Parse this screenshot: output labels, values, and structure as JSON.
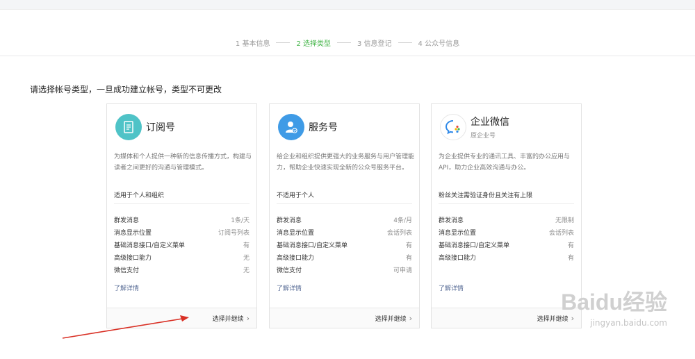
{
  "steps": [
    {
      "label": "1 基本信息"
    },
    {
      "label": "2 选择类型"
    },
    {
      "label": "3 信息登记"
    },
    {
      "label": "4 公众号信息"
    }
  ],
  "prompt": "请选择帐号类型，一旦成功建立帐号，类型不可更改",
  "cards": [
    {
      "title": "订阅号",
      "icon": "subscription-icon",
      "description": "为媒体和个人提供一种新的信息传播方式，构建与读者之间更好的沟通与管理模式。",
      "applies": "适用于个人和组织",
      "features": [
        {
          "name": "群发消息",
          "value": "1条/天"
        },
        {
          "name": "消息显示位置",
          "value": "订阅号列表"
        },
        {
          "name": "基础消息接口/自定义菜单",
          "value": "有"
        },
        {
          "name": "高级接口能力",
          "value": "无"
        },
        {
          "name": "微信支付",
          "value": "无"
        }
      ],
      "more": "了解详情",
      "continue": "选择并继续"
    },
    {
      "title": "服务号",
      "icon": "service-icon",
      "description": "给企业和组织提供更强大的业务服务与用户管理能力，帮助企业快速实现全新的公众号服务平台。",
      "applies": "不适用于个人",
      "features": [
        {
          "name": "群发消息",
          "value": "4条/月"
        },
        {
          "name": "消息显示位置",
          "value": "会话列表"
        },
        {
          "name": "基础消息接口/自定义菜单",
          "value": "有"
        },
        {
          "name": "高级接口能力",
          "value": "有"
        },
        {
          "name": "微信支付",
          "value": "可申请"
        }
      ],
      "more": "了解详情",
      "continue": "选择并继续"
    },
    {
      "title": "企业微信",
      "subtitle": "原企业号",
      "icon": "wecom-icon",
      "description": "为企业提供专业的通讯工具、丰富的办公应用与API，助力企业高效沟通与办公。",
      "applies": "粉丝关注需验证身份且关注有上限",
      "features": [
        {
          "name": "群发消息",
          "value": "无限制"
        },
        {
          "name": "消息显示位置",
          "value": "会话列表"
        },
        {
          "name": "基础消息接口/自定义菜单",
          "value": "有"
        },
        {
          "name": "高级接口能力",
          "value": "有"
        }
      ],
      "more": "了解详情",
      "continue": "选择并继续"
    }
  ],
  "watermark": {
    "brand": "Baidu经验",
    "url": "jingyan.baidu.com"
  },
  "colors": {
    "accent": "#44b549",
    "link": "#576b95",
    "annotation": "#d93025"
  }
}
